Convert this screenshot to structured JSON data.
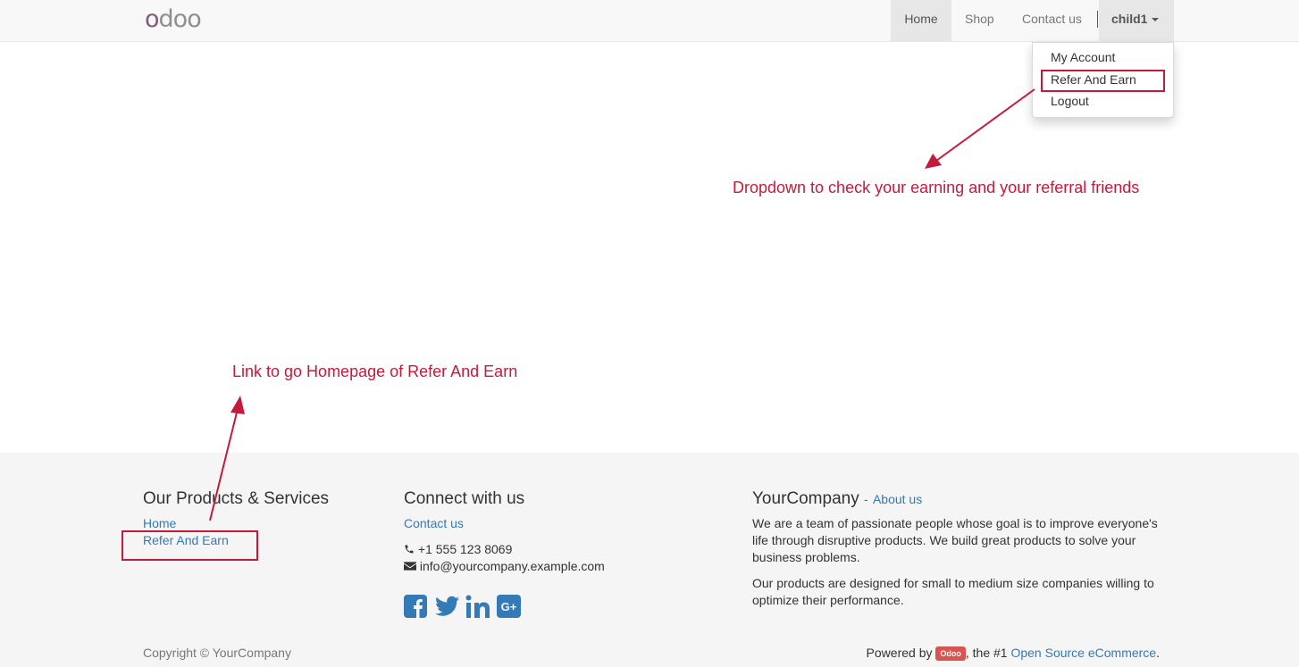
{
  "navbar": {
    "logo": "odoo",
    "items": [
      {
        "label": "Home"
      },
      {
        "label": "Shop"
      },
      {
        "label": "Contact us"
      }
    ],
    "user": "child1",
    "dropdown": [
      "My Account",
      "Refer And Earn",
      "Logout"
    ]
  },
  "annotations": {
    "dropdown_note": "Dropdown to check your earning and your referral friends",
    "link_note": "Link to go Homepage of Refer And Earn",
    "color": "#c41b3d"
  },
  "footer": {
    "products": {
      "heading": "Our Products & Services",
      "links": [
        "Home",
        "Refer And Earn"
      ]
    },
    "connect": {
      "heading": "Connect with us",
      "contact_link": "Contact us",
      "phone": "+1 555 123 8069",
      "email": "info@yourcompany.example.com",
      "social_icons": [
        "facebook-icon",
        "twitter-icon",
        "linkedin-icon",
        "google-plus-icon"
      ]
    },
    "company": {
      "name": "YourCompany",
      "about_link": "About us",
      "para1": "We are a team of passionate people whose goal is to improve everyone's life through disruptive products. We build great products to solve your business problems.",
      "para2": "Our products are designed for small to medium size companies willing to optimize their performance."
    },
    "copyright": "Copyright © YourCompany",
    "powered": {
      "prefix": "Powered by",
      "badge": "Odoo",
      "middle": ", the #1",
      "link": "Open Source eCommerce",
      "suffix": "."
    }
  }
}
